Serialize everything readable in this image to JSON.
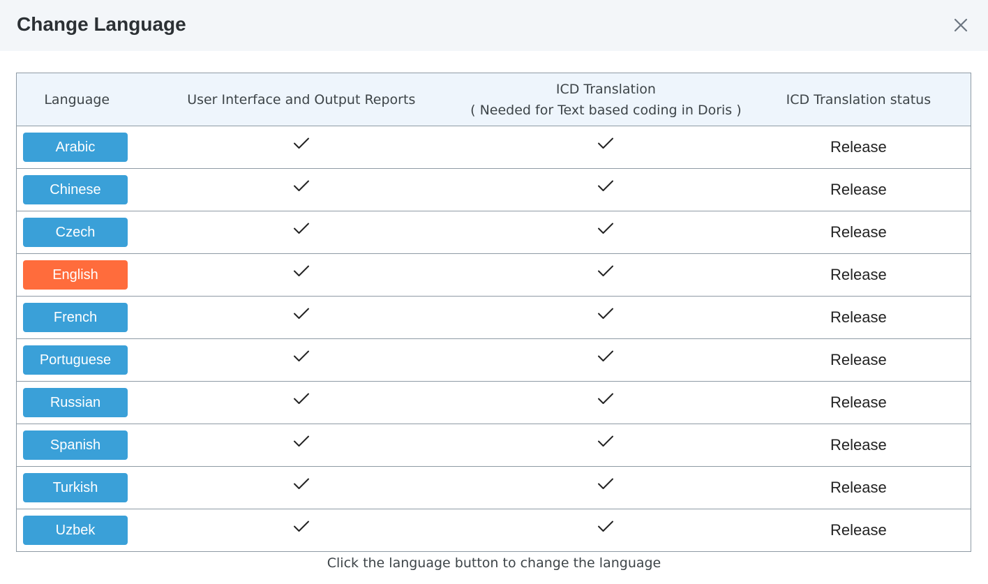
{
  "dialog": {
    "title": "Change Language",
    "close_icon": "close-icon"
  },
  "table": {
    "headers": {
      "language": "Language",
      "ui": "User Interface and Output Reports",
      "icd_line1": "ICD Translation",
      "icd_line2": "( Needed for Text based coding in Doris )",
      "status": "ICD Translation status"
    },
    "rows": [
      {
        "language": "Arabic",
        "ui": true,
        "icd": true,
        "status": "Release",
        "active": false
      },
      {
        "language": "Chinese",
        "ui": true,
        "icd": true,
        "status": "Release",
        "active": false
      },
      {
        "language": "Czech",
        "ui": true,
        "icd": true,
        "status": "Release",
        "active": false
      },
      {
        "language": "English",
        "ui": true,
        "icd": true,
        "status": "Release",
        "active": true
      },
      {
        "language": "French",
        "ui": true,
        "icd": true,
        "status": "Release",
        "active": false
      },
      {
        "language": "Portuguese",
        "ui": true,
        "icd": true,
        "status": "Release",
        "active": false
      },
      {
        "language": "Russian",
        "ui": true,
        "icd": true,
        "status": "Release",
        "active": false
      },
      {
        "language": "Spanish",
        "ui": true,
        "icd": true,
        "status": "Release",
        "active": false
      },
      {
        "language": "Turkish",
        "ui": true,
        "icd": true,
        "status": "Release",
        "active": false
      },
      {
        "language": "Uzbek",
        "ui": true,
        "icd": true,
        "status": "Release",
        "active": false
      }
    ]
  },
  "footer": {
    "note": "Click the language button to change the language"
  },
  "colors": {
    "button": "#3aa0d8",
    "button_active": "#ff6c3c",
    "header_bg": "#eef5fc",
    "dialog_header_bg": "#f3f6f9"
  }
}
